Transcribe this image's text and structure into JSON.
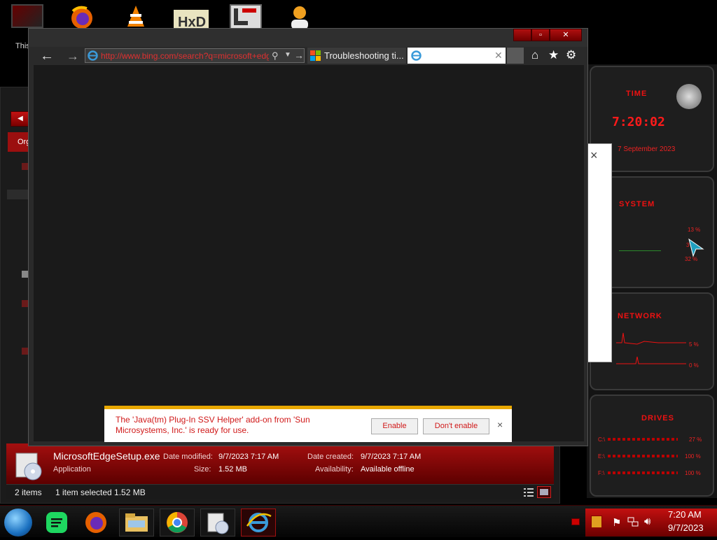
{
  "desktop": {
    "icon_label": "This"
  },
  "browser": {
    "address_url": "http://www.bing.com/search?q=microsoft+edge",
    "tabs": [
      {
        "label": "Troubleshooting ti..."
      },
      {
        "label": ""
      }
    ]
  },
  "notification": {
    "message": "The 'Java(tm) Plug-In SSV Helper' add-on from 'Sun Microsystems, Inc.' is ready for use.",
    "enable_label": "Enable",
    "dont_enable_label": "Don't enable",
    "close_glyph": "×"
  },
  "explorer": {
    "organize_label": "Org",
    "file": {
      "name": "MicrosoftEdgeSetup.exe",
      "type": "Application",
      "date_modified_label": "Date modified:",
      "date_modified": "9/7/2023 7:17 AM",
      "size_label": "Size:",
      "size": "1.52 MB",
      "date_created_label": "Date created:",
      "date_created": "9/7/2023 7:17 AM",
      "availability_label": "Availability:",
      "availability": "Available offline"
    },
    "status": {
      "items_count": "2 items",
      "selection": "1 item selected  1.52 MB"
    }
  },
  "gadgets": {
    "time_title": "TIME",
    "time_value": "7:20:02",
    "date_value": "7 September 2023",
    "system_title": "SYSTEM",
    "system_values": [
      "13 %",
      "3 %",
      "32 %"
    ],
    "network_title": "NETWORK",
    "network_values": [
      "5 %",
      "0 %"
    ],
    "drives_title": "DRIVES",
    "drive_rows": [
      {
        "letter": "C:\\",
        "value": "27 %"
      },
      {
        "letter": "E:\\",
        "value": "100 %"
      },
      {
        "letter": "F:\\",
        "value": "100 %"
      }
    ]
  },
  "taskbar": {
    "clock_time": "7:20 AM",
    "clock_date": "9/7/2023"
  },
  "colors": {
    "accent_red": "#c21010",
    "notif_text": "#d01818",
    "notif_border": "#e8a800"
  }
}
